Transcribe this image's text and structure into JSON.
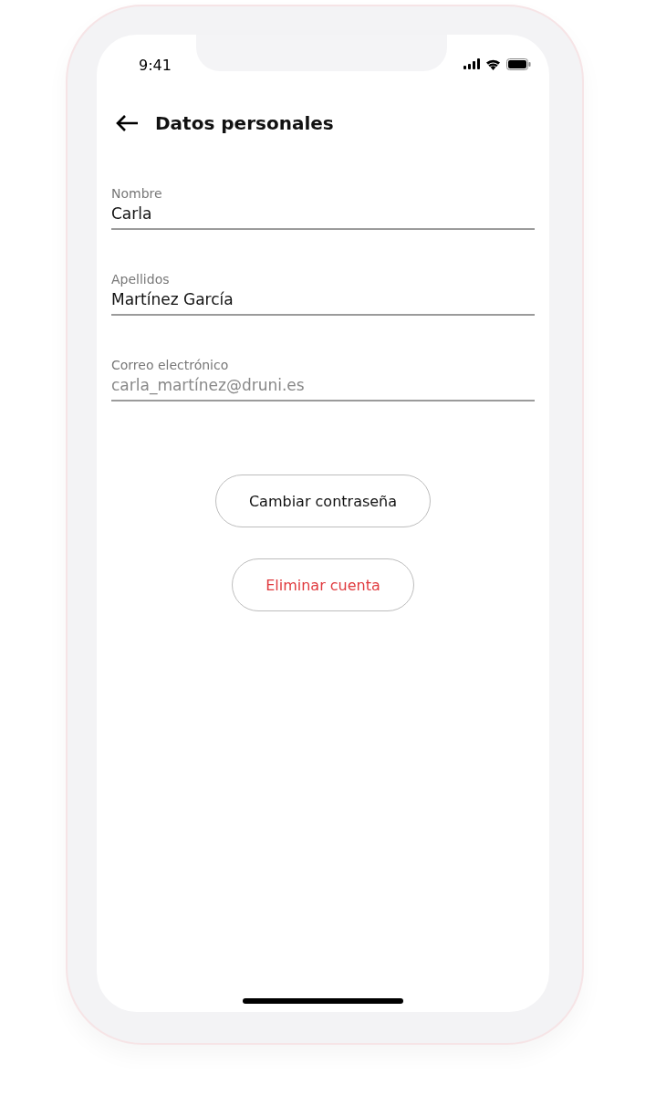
{
  "status_bar": {
    "time": "9:41"
  },
  "header": {
    "title": "Datos personales"
  },
  "fields": [
    {
      "label": "Nombre",
      "value": "Carla",
      "disabled": false
    },
    {
      "label": "Apellidos",
      "value": "Martínez García",
      "disabled": false
    },
    {
      "label": "Correo electrónico",
      "value": "carla_martínez@druni.es",
      "disabled": true
    }
  ],
  "buttons": [
    {
      "label": "Cambiar contraseña",
      "kind": "default"
    },
    {
      "label": "Eliminar cuenta",
      "kind": "danger"
    }
  ]
}
